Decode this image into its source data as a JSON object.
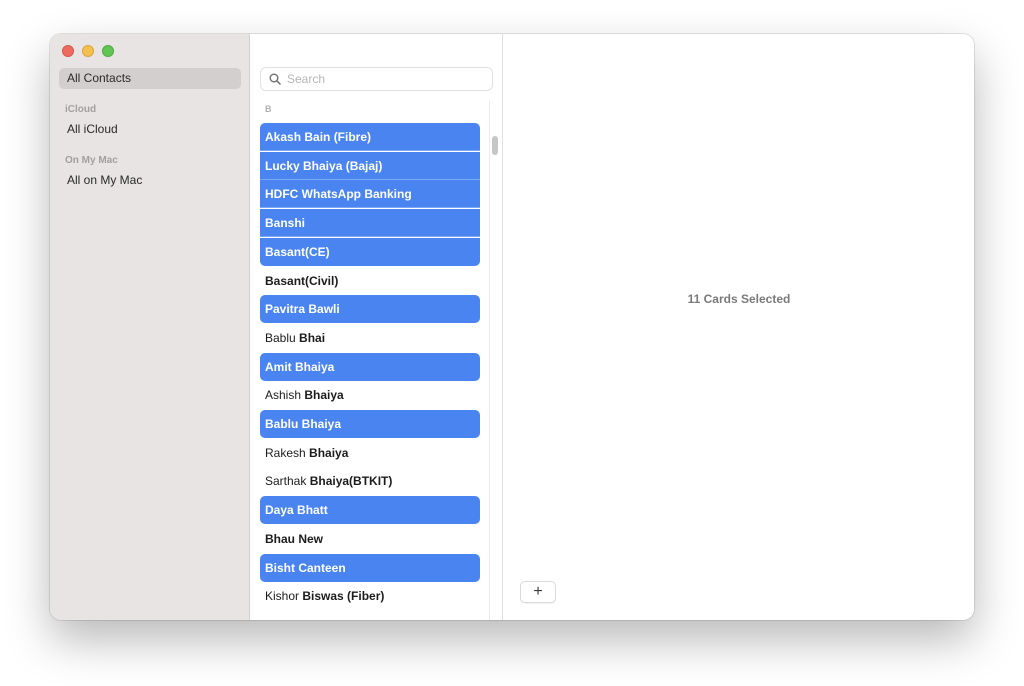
{
  "sidebar": {
    "all_contacts": "All Contacts",
    "icloud_header": "iCloud",
    "all_icloud": "All iCloud",
    "on_my_mac_header": "On My Mac",
    "all_on_my_mac": "All on My Mac"
  },
  "search": {
    "placeholder": "Search",
    "icon": "search-icon"
  },
  "list": {
    "section_letter": "B",
    "contacts": [
      {
        "first": "Akash Bain (Fibre)",
        "last": "",
        "selected": true
      },
      {
        "first": "Lucky Bhaiya (Bajaj)",
        "last": "",
        "selected": true
      },
      {
        "first": "HDFC WhatsApp Banking",
        "last": "",
        "selected": true
      },
      {
        "first": "Banshi",
        "last": "",
        "selected": true
      },
      {
        "first": "Basant(CE)",
        "last": "",
        "selected": true
      },
      {
        "first": "",
        "last": "Basant(Civil)",
        "selected": false
      },
      {
        "first": "Pavitra Bawli",
        "last": "",
        "selected": true
      },
      {
        "first": "Bablu ",
        "last": "Bhai",
        "selected": false
      },
      {
        "first": "Amit Bhaiya",
        "last": "",
        "selected": true
      },
      {
        "first": "Ashish ",
        "last": "Bhaiya",
        "selected": false
      },
      {
        "first": "Bablu Bhaiya",
        "last": "",
        "selected": true
      },
      {
        "first": "Rakesh ",
        "last": "Bhaiya",
        "selected": false
      },
      {
        "first": "Sarthak ",
        "last": "Bhaiya(BTKIT)",
        "selected": false
      },
      {
        "first": "Daya Bhatt",
        "last": "",
        "selected": true
      },
      {
        "first": "",
        "last": "Bhau New",
        "selected": false
      },
      {
        "first": "Bisht Canteen",
        "last": "",
        "selected": true
      },
      {
        "first": "Kishor ",
        "last": "Biswas (Fiber)",
        "selected": false
      }
    ]
  },
  "detail": {
    "selected_count": "11 Cards Selected",
    "add_label": "+"
  },
  "colors": {
    "selection": "#4a84f0",
    "sidebar_bg": "#e7e4e3",
    "sidebar_active": "#d3cfce"
  }
}
